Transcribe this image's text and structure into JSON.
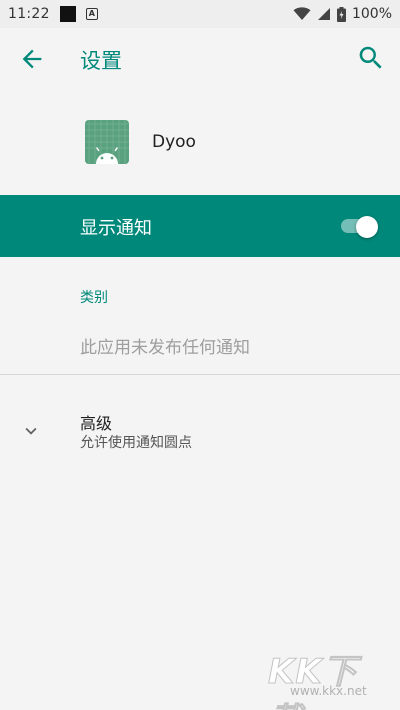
{
  "status_bar": {
    "time": "11:22",
    "battery_text": "100%",
    "icons": [
      "notification-square-icon",
      "notification-a-icon",
      "wifi-icon",
      "cellular-icon",
      "battery-icon"
    ]
  },
  "toolbar": {
    "title": "设置",
    "back_icon": "arrow-left-icon",
    "search_icon": "search-icon"
  },
  "app": {
    "name": "Dyoo",
    "icon": "android-app-icon"
  },
  "notifications_toggle": {
    "label": "显示通知",
    "state": "on"
  },
  "category": {
    "title": "类别",
    "empty_text": "此应用未发布任何通知"
  },
  "advanced": {
    "title": "高级",
    "subtitle": "允许使用通知圆点",
    "icon": "chevron-down-icon"
  },
  "watermark": {
    "brand": "KK下载",
    "url": "www.kkx.net"
  },
  "colors": {
    "accent": "#00897b",
    "background": "#f4f4f4",
    "status_bar": "#eeeeee"
  }
}
